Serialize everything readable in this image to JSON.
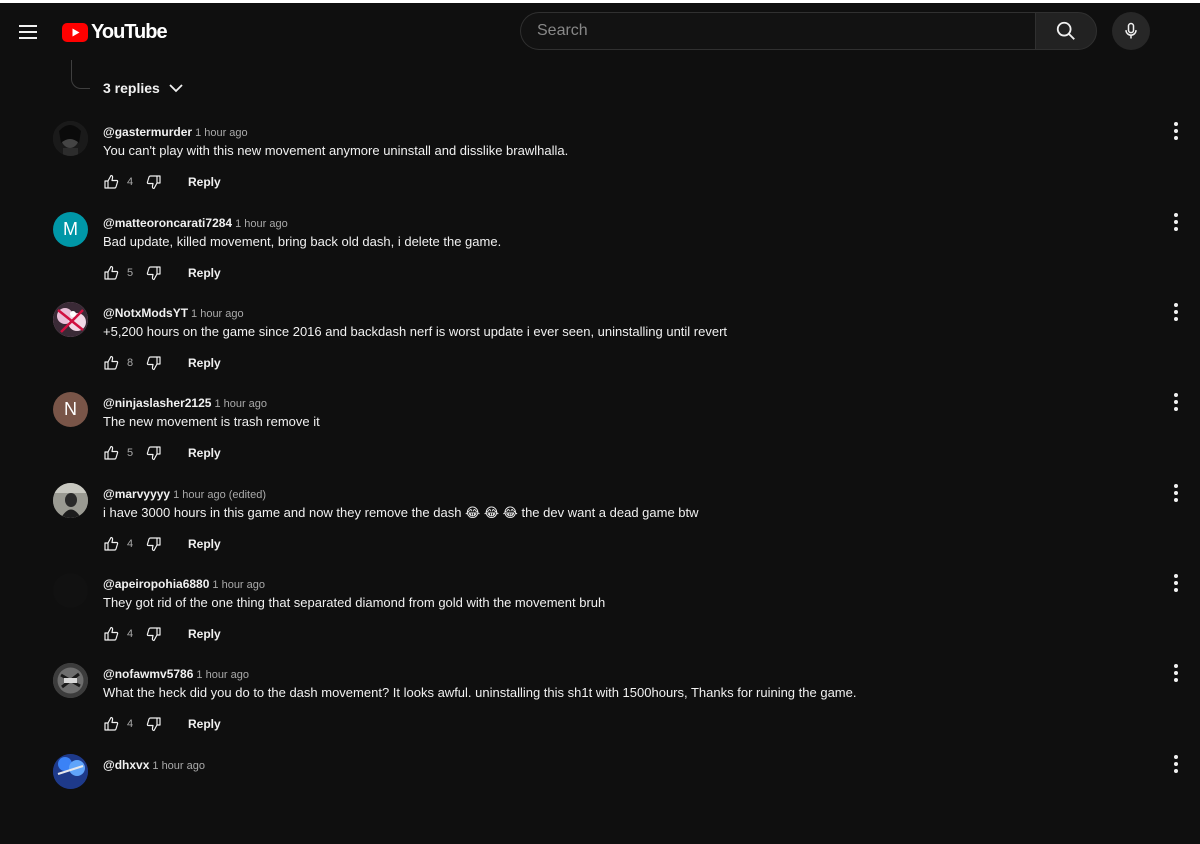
{
  "header": {
    "logo_text": "YouTube",
    "search_placeholder": "Search",
    "icons": {
      "menu": "hamburger-menu-icon",
      "logo": "youtube-play-logo",
      "search": "search-icon",
      "mic": "microphone-icon"
    }
  },
  "thread": {
    "replies_label": "3 replies"
  },
  "comments": [
    {
      "author": "@gastermurder",
      "time": "1 hour ago",
      "edited": "",
      "text": "You can't play with this new movement anymore uninstall and disslike brawlhalla.",
      "likes": "4",
      "reply_label": "Reply",
      "avatar_letter": "",
      "avatar_color": "#2a2a2a"
    },
    {
      "author": "@matteoroncarati7284",
      "time": "1 hour ago",
      "edited": "",
      "text": "Bad update, killed movement, bring back old dash, i delete the game.",
      "likes": "5",
      "reply_label": "Reply",
      "avatar_letter": "M",
      "avatar_color": "#0097a7"
    },
    {
      "author": "@NotxModsYT",
      "time": "1 hour ago",
      "edited": "",
      "text": "+5,200 hours on the game since 2016 and backdash nerf is worst update i ever seen, uninstalling until revert",
      "likes": "8",
      "reply_label": "Reply",
      "avatar_letter": "",
      "avatar_color": "#c9a0b8"
    },
    {
      "author": "@ninjaslasher2125",
      "time": "1 hour ago",
      "edited": "",
      "text": "The new movement is trash remove it",
      "likes": "5",
      "reply_label": "Reply",
      "avatar_letter": "N",
      "avatar_color": "#795548"
    },
    {
      "author": "@marvyyyy",
      "time": "1 hour ago",
      "edited": "(edited)",
      "text": "i have 3000 hours in this game and now they remove the dash 😂 😂 😂  the dev want a dead game btw",
      "likes": "4",
      "reply_label": "Reply",
      "avatar_letter": "",
      "avatar_color": "#8a8a8a"
    },
    {
      "author": "@apeiropohia6880",
      "time": "1 hour ago",
      "edited": "",
      "text": "They got rid of the one thing that separated diamond from gold with the movement bruh",
      "likes": "4",
      "reply_label": "Reply",
      "avatar_letter": "",
      "avatar_color": "#111111"
    },
    {
      "author": "@nofawmv5786",
      "time": "1 hour ago",
      "edited": "",
      "text": "What the heck did you do to the dash movement? It looks awful. uninstalling this sh1t with 1500hours, Thanks for ruining the game.",
      "likes": "4",
      "reply_label": "Reply",
      "avatar_letter": "",
      "avatar_color": "#5a5a5a"
    },
    {
      "author": "@dhxvx",
      "time": "1 hour ago",
      "edited": "",
      "text": "",
      "likes": "",
      "reply_label": "",
      "avatar_letter": "",
      "avatar_color": "#1e3a8a"
    }
  ],
  "colors": {
    "background": "#0f0f0f",
    "brand_red": "#ff0000",
    "text_primary": "#f1f1f1",
    "text_secondary": "#aaaaaa"
  }
}
